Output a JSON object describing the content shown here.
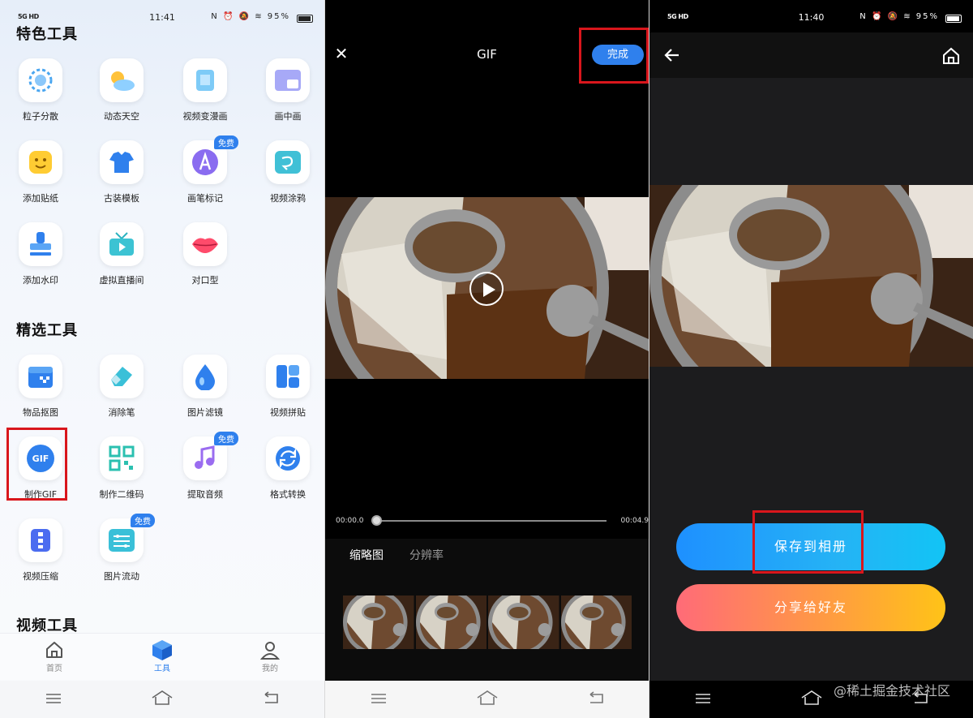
{
  "left_panel": {
    "status": {
      "net": "5G HD",
      "time": "11:41",
      "icons": "N ⏰ 🔕 ≋ 95%"
    },
    "sections": [
      {
        "title": "特色工具",
        "tools": [
          {
            "label": "粒子分散",
            "icon": "particle-icon"
          },
          {
            "label": "动态天空",
            "icon": "sky-icon"
          },
          {
            "label": "视频变漫画",
            "icon": "comic-icon"
          },
          {
            "label": "画中画",
            "icon": "pip-icon"
          },
          {
            "label": "添加贴纸",
            "icon": "sticker-icon"
          },
          {
            "label": "古装模板",
            "icon": "costume-icon"
          },
          {
            "label": "画笔标记",
            "icon": "brush-icon",
            "badge": "免费"
          },
          {
            "label": "视频涂鸦",
            "icon": "doodle-icon"
          },
          {
            "label": "添加水印",
            "icon": "stamp-icon"
          },
          {
            "label": "虚拟直播间",
            "icon": "live-icon"
          },
          {
            "label": "对口型",
            "icon": "lips-icon"
          }
        ]
      },
      {
        "title": "精选工具",
        "tools": [
          {
            "label": "物品抠图",
            "icon": "cutout-icon"
          },
          {
            "label": "消除笔",
            "icon": "eraser-icon"
          },
          {
            "label": "图片滤镜",
            "icon": "filter-icon"
          },
          {
            "label": "视频拼贴",
            "icon": "collage-icon"
          },
          {
            "label": "制作GIF",
            "icon": "gif-icon"
          },
          {
            "label": "制作二维码",
            "icon": "qrcode-icon"
          },
          {
            "label": "提取音频",
            "icon": "music-icon",
            "badge": "免费"
          },
          {
            "label": "格式转换",
            "icon": "convert-icon"
          },
          {
            "label": "视频压缩",
            "icon": "compress-icon"
          },
          {
            "label": "图片流动",
            "icon": "flow-icon",
            "badge": "免费"
          }
        ]
      },
      {
        "title": "视频工具"
      }
    ],
    "gif_icon_text": "GIF",
    "tabs": [
      {
        "label": "首页",
        "icon": "home-icon"
      },
      {
        "label": "工具",
        "icon": "cube-icon",
        "active": true
      },
      {
        "label": "我的",
        "icon": "person-icon"
      }
    ]
  },
  "middle_panel": {
    "title": "GIF",
    "done_label": "完成",
    "time_start": "00:00.0",
    "time_end": "00:04.9",
    "progress": 0,
    "edit_tabs": [
      "缩略图",
      "分辨率"
    ],
    "thumb_count": 4
  },
  "right_panel": {
    "status": {
      "net": "5G HD",
      "time": "11:40",
      "icons": "N ⏰ 🔕 ≋ 95%"
    },
    "save_label": "保存到相册",
    "share_label": "分享给好友"
  },
  "watermark": "@稀土掘金技术社区",
  "colors": {
    "accent": "#2f80ed",
    "highlight": "#d9161c"
  }
}
